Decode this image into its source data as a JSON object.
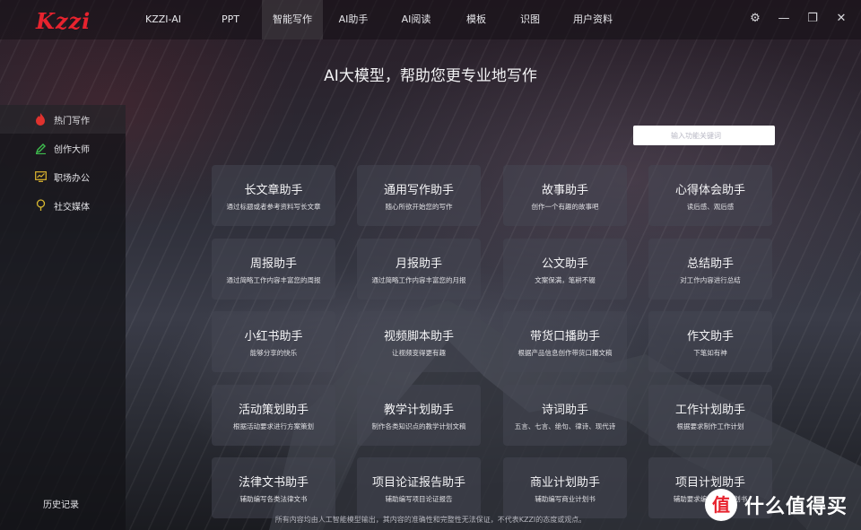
{
  "app": {
    "logo": "Kzzi"
  },
  "nav": {
    "items": [
      "KZZI-AI",
      "PPT",
      "智能写作",
      "AI助手",
      "AI阅读",
      "模板",
      "识图",
      "用户资料"
    ],
    "active": "智能写作"
  },
  "window_controls": {
    "settings_icon": "⚙",
    "minimize_icon": "—",
    "restore_icon": "❐",
    "close_icon": "✕"
  },
  "hero": {
    "title": "AI大模型，帮助您更专业地写作"
  },
  "sidebar": {
    "items": [
      {
        "label": "热门写作",
        "icon": "flame-icon",
        "color": "#e0322e"
      },
      {
        "label": "创作大师",
        "icon": "pen-icon",
        "color": "#3fbf4f"
      },
      {
        "label": "职场办公",
        "icon": "chart-icon",
        "color": "#e0b830"
      },
      {
        "label": "社交媒体",
        "icon": "bulb-icon",
        "color": "#d8b830"
      }
    ],
    "history_label": "历史记录"
  },
  "search": {
    "placeholder": "输入功能关键词",
    "value": ""
  },
  "cards": [
    {
      "title": "长文章助手",
      "subtitle": "通过标题或者参考资料写长文章"
    },
    {
      "title": "通用写作助手",
      "subtitle": "随心所欲开始您的写作"
    },
    {
      "title": "故事助手",
      "subtitle": "创作一个有趣的故事吧"
    },
    {
      "title": "心得体会助手",
      "subtitle": "读后感、观后感"
    },
    {
      "title": "周报助手",
      "subtitle": "通过简略工作内容丰富您的周报"
    },
    {
      "title": "月报助手",
      "subtitle": "通过简略工作内容丰富您的月报"
    },
    {
      "title": "公文助手",
      "subtitle": "文案保满，笔耕不辍"
    },
    {
      "title": "总结助手",
      "subtitle": "对工作内容进行总结"
    },
    {
      "title": "小红书助手",
      "subtitle": "能够分享的快乐"
    },
    {
      "title": "视频脚本助手",
      "subtitle": "让视频变得更有趣"
    },
    {
      "title": "带货口播助手",
      "subtitle": "根据产品信息创作带货口播文稿"
    },
    {
      "title": "作文助手",
      "subtitle": "下笔如有神"
    },
    {
      "title": "活动策划助手",
      "subtitle": "根据活动要求进行方案策划"
    },
    {
      "title": "教学计划助手",
      "subtitle": "制作各类知识点的教学计划文稿"
    },
    {
      "title": "诗词助手",
      "subtitle": "五言、七言、绝句、律诗、现代诗"
    },
    {
      "title": "工作计划助手",
      "subtitle": "根据要求制作工作计划"
    },
    {
      "title": "法律文书助手",
      "subtitle": "辅助编写各类法律文书"
    },
    {
      "title": "项目论证报告助手",
      "subtitle": "辅助编写项目论证报告"
    },
    {
      "title": "商业计划助手",
      "subtitle": "辅助编写商业计划书"
    },
    {
      "title": "项目计划助手",
      "subtitle": "辅助要求编写项目计划书"
    }
  ],
  "disclaimer": "所有内容均由人工智能模型输出，其内容的准确性和完整性无法保证，不代表KZZI的态度或观点。",
  "watermark": {
    "badge": "值",
    "text": "什么值得买"
  },
  "colors": {
    "accent": "#e8232e",
    "search_bg": "#ffffff"
  }
}
